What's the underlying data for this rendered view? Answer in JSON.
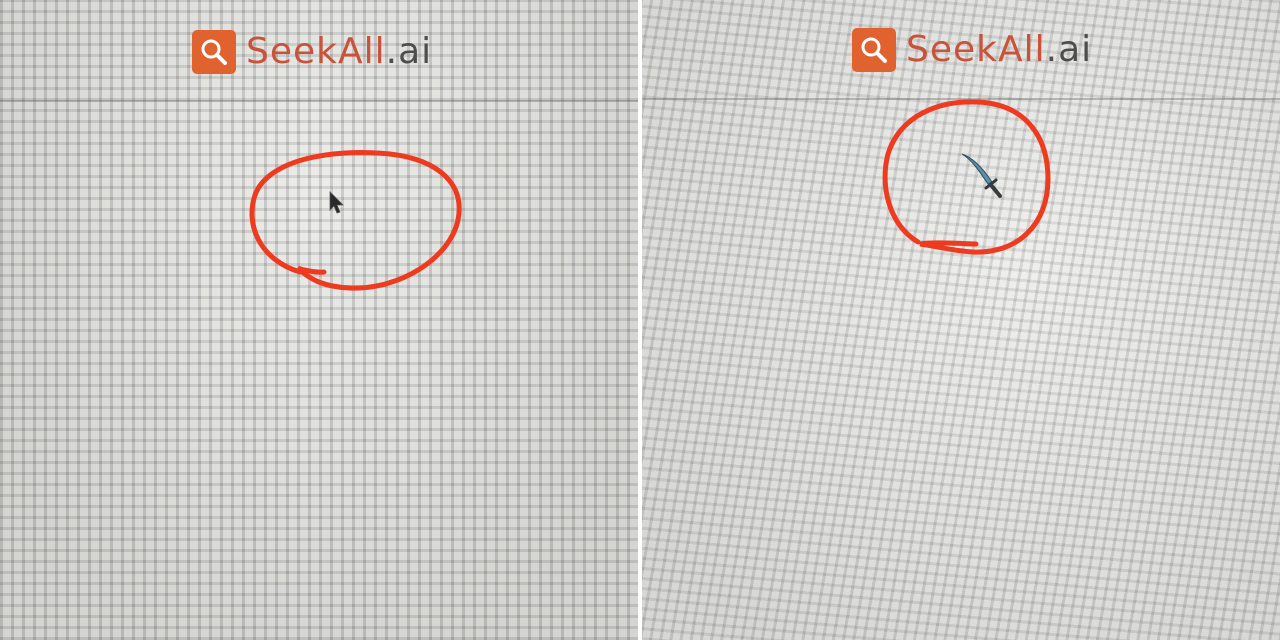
{
  "colors": {
    "brand_orange": "#e0622e",
    "brand_text": "#c8533a",
    "brand_text_dark": "#4d4d4d",
    "annotation_red": "#ee3a1f"
  },
  "panels": [
    {
      "id": "left",
      "logo": {
        "name_part1": "SeekAll",
        "name_part2": ".ai",
        "icon": "search-magnifier-icon"
      },
      "highlighted_item": {
        "icon": "arrow-pointer-cursor-icon"
      }
    },
    {
      "id": "right",
      "logo": {
        "name_part1": "SeekAll",
        "name_part2": ".ai",
        "icon": "search-magnifier-icon"
      },
      "highlighted_item": {
        "icon": "sword-cursor-icon"
      }
    }
  ]
}
